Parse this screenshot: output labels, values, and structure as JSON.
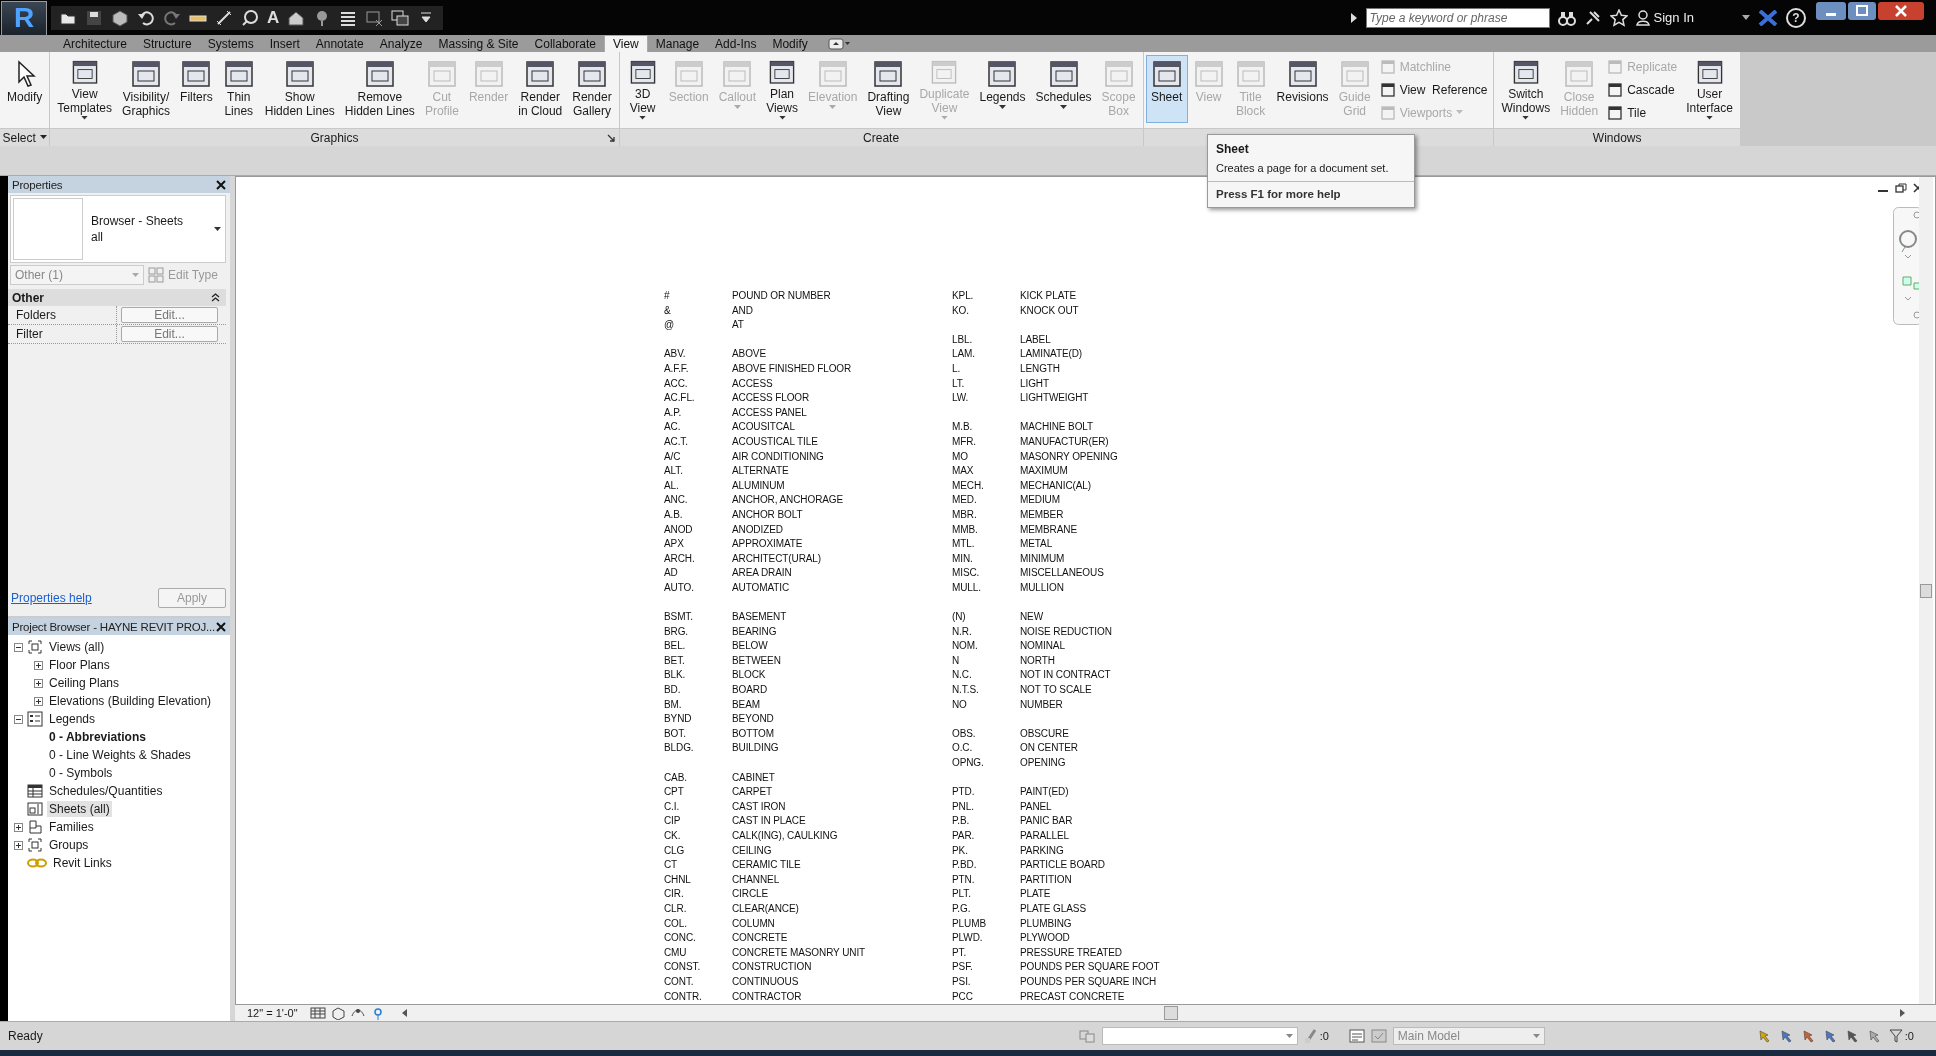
{
  "app_logo": "R",
  "quick_access": {
    "text_tool": "A"
  },
  "infocenter": {
    "search_placeholder": "Type a keyword or phrase",
    "sign_in": "Sign In",
    "help": "?"
  },
  "tabs": [
    {
      "label": "Architecture",
      "selected": false
    },
    {
      "label": "Structure",
      "selected": false
    },
    {
      "label": "Systems",
      "selected": false
    },
    {
      "label": "Insert",
      "selected": false
    },
    {
      "label": "Annotate",
      "selected": false
    },
    {
      "label": "Analyze",
      "selected": false
    },
    {
      "label": "Massing & Site",
      "selected": false
    },
    {
      "label": "Collaborate",
      "selected": false
    },
    {
      "label": "View",
      "selected": true
    },
    {
      "label": "Manage",
      "selected": false
    },
    {
      "label": "Add-Ins",
      "selected": false
    },
    {
      "label": "Modify",
      "selected": false
    }
  ],
  "ribbon": {
    "panels": [
      {
        "title": "Select",
        "title_dropdown": true,
        "buttons": [
          {
            "kind": "pointer",
            "lines": [
              "Modify"
            ],
            "disabled": false,
            "selected": false,
            "dropdown": false
          }
        ]
      },
      {
        "title": "Graphics",
        "launcher": true,
        "buttons": [
          {
            "kind": "large",
            "lines": [
              "View",
              "Templates"
            ],
            "disabled": false,
            "selected": false,
            "dropdown": true
          },
          {
            "kind": "large",
            "lines": [
              "Visibility/",
              "Graphics"
            ],
            "disabled": false,
            "selected": false,
            "dropdown": false
          },
          {
            "kind": "large",
            "lines": [
              "Filters"
            ],
            "disabled": false,
            "selected": false,
            "dropdown": false
          },
          {
            "kind": "large",
            "lines": [
              "Thin",
              "Lines"
            ],
            "disabled": false,
            "selected": false,
            "dropdown": false
          },
          {
            "kind": "large",
            "lines": [
              "Show",
              "Hidden Lines"
            ],
            "disabled": false,
            "selected": false,
            "dropdown": false
          },
          {
            "kind": "large",
            "lines": [
              "Remove",
              "Hidden Lines"
            ],
            "disabled": false,
            "selected": false,
            "dropdown": false
          },
          {
            "kind": "large",
            "lines": [
              "Cut",
              "Profile"
            ],
            "disabled": true,
            "selected": false,
            "dropdown": false
          },
          {
            "kind": "large",
            "lines": [
              "Render"
            ],
            "disabled": true,
            "selected": false,
            "dropdown": false
          },
          {
            "kind": "large",
            "lines": [
              "Render",
              "in Cloud"
            ],
            "disabled": false,
            "selected": false,
            "dropdown": false
          },
          {
            "kind": "large",
            "lines": [
              "Render",
              "Gallery"
            ],
            "disabled": false,
            "selected": false,
            "dropdown": false
          }
        ]
      },
      {
        "title": "Create",
        "buttons": [
          {
            "kind": "large",
            "lines": [
              "3D",
              "View"
            ],
            "disabled": false,
            "selected": false,
            "dropdown": true
          },
          {
            "kind": "large",
            "lines": [
              "Section"
            ],
            "disabled": true,
            "selected": false,
            "dropdown": false
          },
          {
            "kind": "large",
            "lines": [
              "Callout"
            ],
            "disabled": true,
            "selected": false,
            "dropdown": true
          },
          {
            "kind": "large",
            "lines": [
              "Plan",
              "Views"
            ],
            "disabled": false,
            "selected": false,
            "dropdown": true
          },
          {
            "kind": "large",
            "lines": [
              "Elevation"
            ],
            "disabled": true,
            "selected": false,
            "dropdown": true
          },
          {
            "kind": "large",
            "lines": [
              "Drafting",
              "View"
            ],
            "disabled": false,
            "selected": false,
            "dropdown": false
          },
          {
            "kind": "large",
            "lines": [
              "Duplicate",
              "View"
            ],
            "disabled": true,
            "selected": false,
            "dropdown": true
          },
          {
            "kind": "large",
            "lines": [
              "Legends"
            ],
            "disabled": false,
            "selected": false,
            "dropdown": true
          },
          {
            "kind": "large",
            "lines": [
              "Schedules"
            ],
            "disabled": false,
            "selected": false,
            "dropdown": true
          },
          {
            "kind": "large",
            "lines": [
              "Scope",
              "Box"
            ],
            "disabled": true,
            "selected": false,
            "dropdown": false
          }
        ]
      },
      {
        "buttons": [
          {
            "kind": "large",
            "lines": [
              "Sheet"
            ],
            "disabled": false,
            "selected": true,
            "dropdown": false
          },
          {
            "kind": "large",
            "lines": [
              "View"
            ],
            "disabled": true,
            "selected": false,
            "dropdown": false
          },
          {
            "kind": "large",
            "lines": [
              "Title",
              "Block"
            ],
            "disabled": true,
            "selected": false,
            "dropdown": false
          },
          {
            "kind": "large",
            "lines": [
              "Revisions"
            ],
            "disabled": false,
            "selected": false,
            "dropdown": false
          },
          {
            "kind": "large",
            "lines": [
              "Guide",
              "Grid"
            ],
            "disabled": true,
            "selected": false,
            "dropdown": false
          },
          {
            "kind": "stack",
            "items": [
              {
                "label": "Matchline",
                "disabled": true,
                "dropdown": false
              },
              {
                "label": "View  Reference",
                "disabled": false,
                "dropdown": false
              },
              {
                "label": "Viewports",
                "disabled": true,
                "dropdown": true
              }
            ]
          }
        ]
      },
      {
        "title": "Windows",
        "buttons": [
          {
            "kind": "large",
            "lines": [
              "Switch",
              "Windows"
            ],
            "disabled": false,
            "selected": false,
            "dropdown": true
          },
          {
            "kind": "large",
            "lines": [
              "Close",
              "Hidden"
            ],
            "disabled": true,
            "selected": false,
            "dropdown": false
          },
          {
            "kind": "stack",
            "items": [
              {
                "label": "Replicate",
                "disabled": true,
                "dropdown": false
              },
              {
                "label": "Cascade",
                "disabled": false,
                "dropdown": false
              },
              {
                "label": "Tile",
                "disabled": false,
                "dropdown": false
              }
            ]
          },
          {
            "kind": "large",
            "lines": [
              "User",
              "Interface"
            ],
            "disabled": false,
            "selected": false,
            "dropdown": true
          }
        ]
      }
    ]
  },
  "tooltip": {
    "title": "Sheet",
    "text": "Creates a page for a document set.",
    "help": "Press F1 for more help"
  },
  "properties": {
    "title": "Properties",
    "type_name": "Browser - Sheets",
    "type_sub": "all",
    "instance_filter": "Other (1)",
    "edit_type": "Edit Type",
    "edit_type_disabled": true,
    "category": "Other",
    "rows": [
      {
        "name": "Folders",
        "value": "Edit..."
      },
      {
        "name": "Filter",
        "value": "Edit..."
      }
    ],
    "help_link": "Properties help",
    "apply": "Apply",
    "apply_disabled": true
  },
  "project_browser": {
    "title": "Project Browser - HAYNE REVIT PROJ...",
    "tree": [
      {
        "label": "Views (all)",
        "kind": "views",
        "expanded": true,
        "selected": false,
        "open": false,
        "children": [
          {
            "label": "Floor Plans",
            "expanded": false,
            "selected": false,
            "open": false
          },
          {
            "label": "Ceiling Plans",
            "expanded": false,
            "selected": false,
            "open": false
          },
          {
            "label": "Elevations (Building Elevation)",
            "expanded": false,
            "selected": false,
            "open": false
          }
        ]
      },
      {
        "label": "Legends",
        "kind": "legends",
        "expanded": true,
        "selected": false,
        "open": false,
        "children": [
          {
            "label": "0 - Abbreviations",
            "selected": false,
            "open": true
          },
          {
            "label": "0 - Line Weights & Shades",
            "selected": false,
            "open": false
          },
          {
            "label": "0 - Symbols",
            "selected": false,
            "open": false
          }
        ]
      },
      {
        "label": "Schedules/Quantities",
        "kind": "schedules",
        "selected": false,
        "open": false
      },
      {
        "label": "Sheets (all)",
        "kind": "sheets",
        "selected": true,
        "open": false
      },
      {
        "label": "Families",
        "kind": "families",
        "expanded": false,
        "selected": false,
        "open": false
      },
      {
        "label": "Groups",
        "kind": "groups",
        "expanded": false,
        "selected": false,
        "open": false
      },
      {
        "label": "Revit Links",
        "kind": "links",
        "selected": false,
        "open": false
      }
    ]
  },
  "legend_columns": [
    [
      [
        {
          "abbr": "#",
          "meaning": "POUND OR NUMBER"
        },
        {
          "abbr": "&",
          "meaning": "AND"
        },
        {
          "abbr": "@",
          "meaning": "AT"
        }
      ],
      [
        {
          "abbr": "ABV.",
          "meaning": "ABOVE"
        },
        {
          "abbr": "A.F.F.",
          "meaning": "ABOVE FINISHED FLOOR"
        },
        {
          "abbr": "ACC.",
          "meaning": "ACCESS"
        },
        {
          "abbr": "AC.FL.",
          "meaning": "ACCESS FLOOR"
        },
        {
          "abbr": "A.P.",
          "meaning": "ACCESS PANEL"
        },
        {
          "abbr": "AC.",
          "meaning": "ACOUSITCAL"
        },
        {
          "abbr": "AC.T.",
          "meaning": "ACOUSTICAL TILE"
        },
        {
          "abbr": "A/C",
          "meaning": "AIR CONDITIONING"
        },
        {
          "abbr": "ALT.",
          "meaning": "ALTERNATE"
        },
        {
          "abbr": "AL.",
          "meaning": "ALUMINUM"
        },
        {
          "abbr": "ANC.",
          "meaning": "ANCHOR, ANCHORAGE"
        },
        {
          "abbr": "A.B.",
          "meaning": "ANCHOR BOLT"
        },
        {
          "abbr": "ANOD",
          "meaning": "ANODIZED"
        },
        {
          "abbr": "APX",
          "meaning": "APPROXIMATE"
        },
        {
          "abbr": "ARCH.",
          "meaning": "ARCHITECT(URAL)"
        },
        {
          "abbr": "AD",
          "meaning": "AREA DRAIN"
        },
        {
          "abbr": "AUTO.",
          "meaning": "AUTOMATIC"
        }
      ],
      [
        {
          "abbr": "BSMT.",
          "meaning": "BASEMENT"
        },
        {
          "abbr": "BRG.",
          "meaning": "BEARING"
        },
        {
          "abbr": "BEL.",
          "meaning": "BELOW"
        },
        {
          "abbr": "BET.",
          "meaning": "BETWEEN"
        },
        {
          "abbr": "BLK.",
          "meaning": "BLOCK"
        },
        {
          "abbr": "BD.",
          "meaning": "BOARD"
        },
        {
          "abbr": "BM.",
          "meaning": "BEAM"
        },
        {
          "abbr": "BYND",
          "meaning": "BEYOND"
        },
        {
          "abbr": "BOT.",
          "meaning": "BOTTOM"
        },
        {
          "abbr": "BLDG.",
          "meaning": "BUILDING"
        }
      ],
      [
        {
          "abbr": "CAB.",
          "meaning": "CABINET"
        },
        {
          "abbr": "CPT",
          "meaning": "CARPET"
        },
        {
          "abbr": "C.I.",
          "meaning": "CAST IRON"
        },
        {
          "abbr": "CIP",
          "meaning": "CAST IN PLACE"
        },
        {
          "abbr": "CK.",
          "meaning": "CALK(ING), CAULKING"
        },
        {
          "abbr": "CLG",
          "meaning": "CEILING"
        },
        {
          "abbr": "CT",
          "meaning": "CERAMIC TILE"
        },
        {
          "abbr": "CHNL",
          "meaning": "CHANNEL"
        },
        {
          "abbr": "CIR.",
          "meaning": "CIRCLE"
        },
        {
          "abbr": "CLR.",
          "meaning": "CLEAR(ANCE)"
        },
        {
          "abbr": "COL.",
          "meaning": "COLUMN"
        },
        {
          "abbr": "CONC.",
          "meaning": "CONCRETE"
        },
        {
          "abbr": "CMU",
          "meaning": "CONCRETE MASONRY UNIT"
        },
        {
          "abbr": "CONST.",
          "meaning": "CONSTRUCTION"
        },
        {
          "abbr": "CONT.",
          "meaning": "CONTINUOUS"
        },
        {
          "abbr": "CONTR.",
          "meaning": "CONTRACTOR"
        }
      ]
    ],
    [
      [
        {
          "abbr": "KPL.",
          "meaning": "KICK PLATE"
        },
        {
          "abbr": "KO.",
          "meaning": "KNOCK OUT"
        }
      ],
      [
        {
          "abbr": "LBL.",
          "meaning": "LABEL"
        },
        {
          "abbr": "LAM.",
          "meaning": "LAMINATE(D)"
        },
        {
          "abbr": "L.",
          "meaning": "LENGTH"
        },
        {
          "abbr": "LT.",
          "meaning": "LIGHT"
        },
        {
          "abbr": "LW.",
          "meaning": "LIGHTWEIGHT"
        }
      ],
      [
        {
          "abbr": "M.B.",
          "meaning": "MACHINE BOLT"
        },
        {
          "abbr": "MFR.",
          "meaning": "MANUFACTUR(ER)"
        },
        {
          "abbr": "MO",
          "meaning": "MASONRY OPENING"
        },
        {
          "abbr": "MAX",
          "meaning": "MAXIMUM"
        },
        {
          "abbr": "MECH.",
          "meaning": "MECHANIC(AL)"
        },
        {
          "abbr": "MED.",
          "meaning": "MEDIUM"
        },
        {
          "abbr": "MBR.",
          "meaning": "MEMBER"
        },
        {
          "abbr": "MMB.",
          "meaning": "MEMBRANE"
        },
        {
          "abbr": "MTL.",
          "meaning": "METAL"
        },
        {
          "abbr": "MIN.",
          "meaning": "MINIMUM"
        },
        {
          "abbr": "MISC.",
          "meaning": "MISCELLANEOUS"
        },
        {
          "abbr": "MULL.",
          "meaning": "MULLION"
        }
      ],
      [
        {
          "abbr": "(N)",
          "meaning": "NEW"
        },
        {
          "abbr": "N.R.",
          "meaning": "NOISE REDUCTION"
        },
        {
          "abbr": "NOM.",
          "meaning": "NOMINAL"
        },
        {
          "abbr": "N",
          "meaning": "NORTH"
        },
        {
          "abbr": "N.C.",
          "meaning": "NOT IN CONTRACT"
        },
        {
          "abbr": "N.T.S.",
          "meaning": "NOT TO SCALE"
        },
        {
          "abbr": "NO",
          "meaning": "NUMBER"
        }
      ],
      [
        {
          "abbr": "OBS.",
          "meaning": "OBSCURE"
        },
        {
          "abbr": "O.C.",
          "meaning": "ON CENTER"
        },
        {
          "abbr": "OPNG.",
          "meaning": "OPENING"
        }
      ],
      [
        {
          "abbr": "PTD.",
          "meaning": "PAINT(ED)"
        },
        {
          "abbr": "PNL.",
          "meaning": "PANEL"
        },
        {
          "abbr": "P.B.",
          "meaning": "PANIC BAR"
        },
        {
          "abbr": "PAR.",
          "meaning": "PARALLEL"
        },
        {
          "abbr": "PK.",
          "meaning": "PARKING"
        },
        {
          "abbr": "P.BD.",
          "meaning": "PARTICLE BOARD"
        },
        {
          "abbr": "PTN.",
          "meaning": "PARTITION"
        },
        {
          "abbr": "PLT.",
          "meaning": "PLATE"
        },
        {
          "abbr": "P.G.",
          "meaning": "PLATE GLASS"
        },
        {
          "abbr": "PLUMB",
          "meaning": "PLUMBING"
        },
        {
          "abbr": "PLWD.",
          "meaning": "PLYWOOD"
        },
        {
          "abbr": "PT.",
          "meaning": "PRESSURE TREATED"
        },
        {
          "abbr": "PSF.",
          "meaning": "POUNDS PER SQUARE FOOT"
        },
        {
          "abbr": "PSI.",
          "meaning": "POUNDS PER SQUARE INCH"
        },
        {
          "abbr": "PCC",
          "meaning": "PRECAST CONCRETE"
        }
      ]
    ]
  ],
  "view_control": {
    "scale": "12\" = 1'-0\""
  },
  "status_bar": {
    "message": "Ready",
    "worksets_count": ":0",
    "model": "Main Model",
    "filter_count": ":0"
  }
}
